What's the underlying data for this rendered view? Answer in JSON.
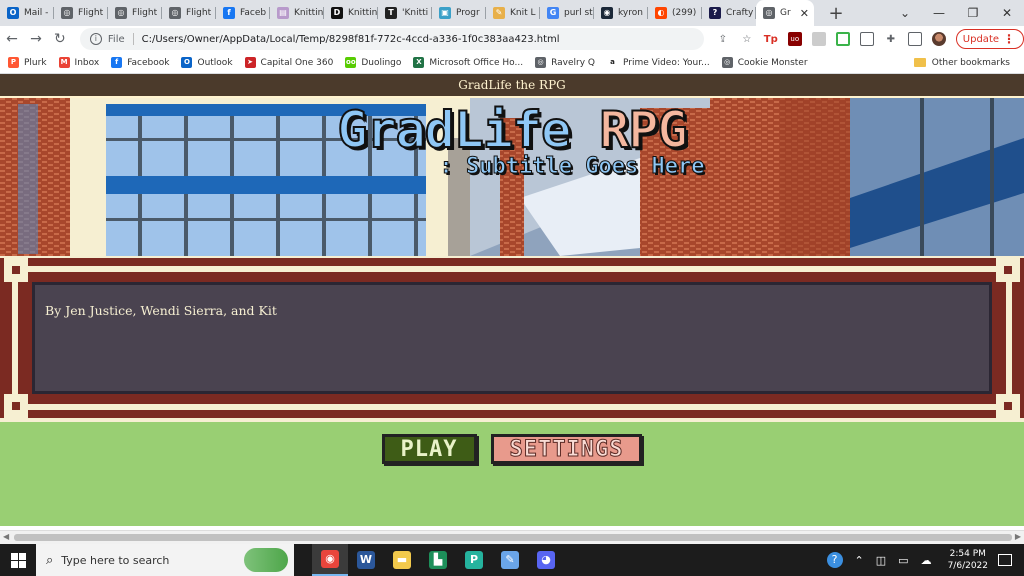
{
  "browser": {
    "tabs": [
      {
        "label": "Mail -",
        "color": "#0a64c8",
        "glyph": "O"
      },
      {
        "label": "Flight",
        "color": "#5f6368",
        "glyph": "◎"
      },
      {
        "label": "Flight",
        "color": "#5f6368",
        "glyph": "◎"
      },
      {
        "label": "Flight",
        "color": "#5f6368",
        "glyph": "◎"
      },
      {
        "label": "Faceb",
        "color": "#1877f2",
        "glyph": "f"
      },
      {
        "label": "Knittin",
        "color": "#b89acb",
        "glyph": "▤"
      },
      {
        "label": "Knittin",
        "color": "#111111",
        "glyph": "D"
      },
      {
        "label": "'Knitti",
        "color": "#222222",
        "glyph": "T"
      },
      {
        "label": "Progr",
        "color": "#3aa0c8",
        "glyph": "▣"
      },
      {
        "label": "Knit L",
        "color": "#e8b04a",
        "glyph": "✎"
      },
      {
        "label": "purl st",
        "color": "#4285f4",
        "glyph": "G"
      },
      {
        "label": "kyron",
        "color": "#1b2838",
        "glyph": "◉"
      },
      {
        "label": "(299)",
        "color": "#ff4500",
        "glyph": "◐"
      },
      {
        "label": "Crafty",
        "color": "#1a1a4a",
        "glyph": "?"
      },
      {
        "label": "Gr",
        "color": "#5f6368",
        "glyph": "◎"
      }
    ],
    "new_tab": "+",
    "window_controls": [
      "⌄",
      "—",
      "❐",
      "✕"
    ],
    "address": {
      "scheme": "File",
      "url": "C:/Users/Owner/AppData/Local/Temp/8298f81f-772c-4ccd-a336-1f0c383aa423.html"
    },
    "update_label": "Update",
    "bookmarks": [
      {
        "label": "Plurk",
        "color": "#ff5733",
        "glyph": "P"
      },
      {
        "label": "Inbox",
        "color": "#ea4335",
        "glyph": "M"
      },
      {
        "label": "Facebook",
        "color": "#1877f2",
        "glyph": "f"
      },
      {
        "label": "Outlook",
        "color": "#0a64c8",
        "glyph": "O"
      },
      {
        "label": "Capital One 360",
        "color": "#cc2427",
        "glyph": "➤"
      },
      {
        "label": "Duolingo",
        "color": "#58cc02",
        "glyph": "oo"
      },
      {
        "label": "Microsoft Office Ho...",
        "color": "#217346",
        "glyph": "X"
      },
      {
        "label": "Ravelry Q",
        "color": "#5f6368",
        "glyph": "◎"
      },
      {
        "label": "Prime Video: Your...",
        "color": "#ffffff",
        "glyph": "a"
      },
      {
        "label": "Cookie Monster",
        "color": "#5f6368",
        "glyph": "◎"
      }
    ],
    "other_bookmarks": "Other bookmarks"
  },
  "game": {
    "window_title": "GradLife the RPG",
    "title_part1": "GradLife",
    "title_part2": "RPG",
    "subtitle": ": Subtitle Goes Here",
    "dialog_text": "By Jen Justice, Wendi Sierra, and Kit",
    "play_label": "PLAY",
    "settings_label": "SETTINGS",
    "colors": {
      "title_bar": "#4b3a2b",
      "frame": "#7b2a22",
      "dialog_bg": "#4a4350",
      "menu_bg": "#99cf73",
      "play_btn": "#3e5c16",
      "settings_btn": "#e89a8c"
    }
  },
  "taskbar": {
    "search_placeholder": "Type here to search",
    "apps": [
      {
        "name": "chrome",
        "color": "#e8453c",
        "glyph": "◉",
        "active": true
      },
      {
        "name": "word",
        "color": "#2b579a",
        "glyph": "W",
        "active": false
      },
      {
        "name": "file-explorer",
        "color": "#f2c94c",
        "glyph": "▬",
        "active": false
      },
      {
        "name": "app-green",
        "color": "#1d8f5a",
        "glyph": "▙",
        "active": false
      },
      {
        "name": "app-teal",
        "color": "#25b39e",
        "glyph": "P",
        "active": false
      },
      {
        "name": "paint",
        "color": "#6aa5e8",
        "glyph": "✎",
        "active": false
      },
      {
        "name": "discord",
        "color": "#5865f2",
        "glyph": "◕",
        "active": false
      }
    ],
    "time": "2:54 PM",
    "date": "7/6/2022"
  }
}
